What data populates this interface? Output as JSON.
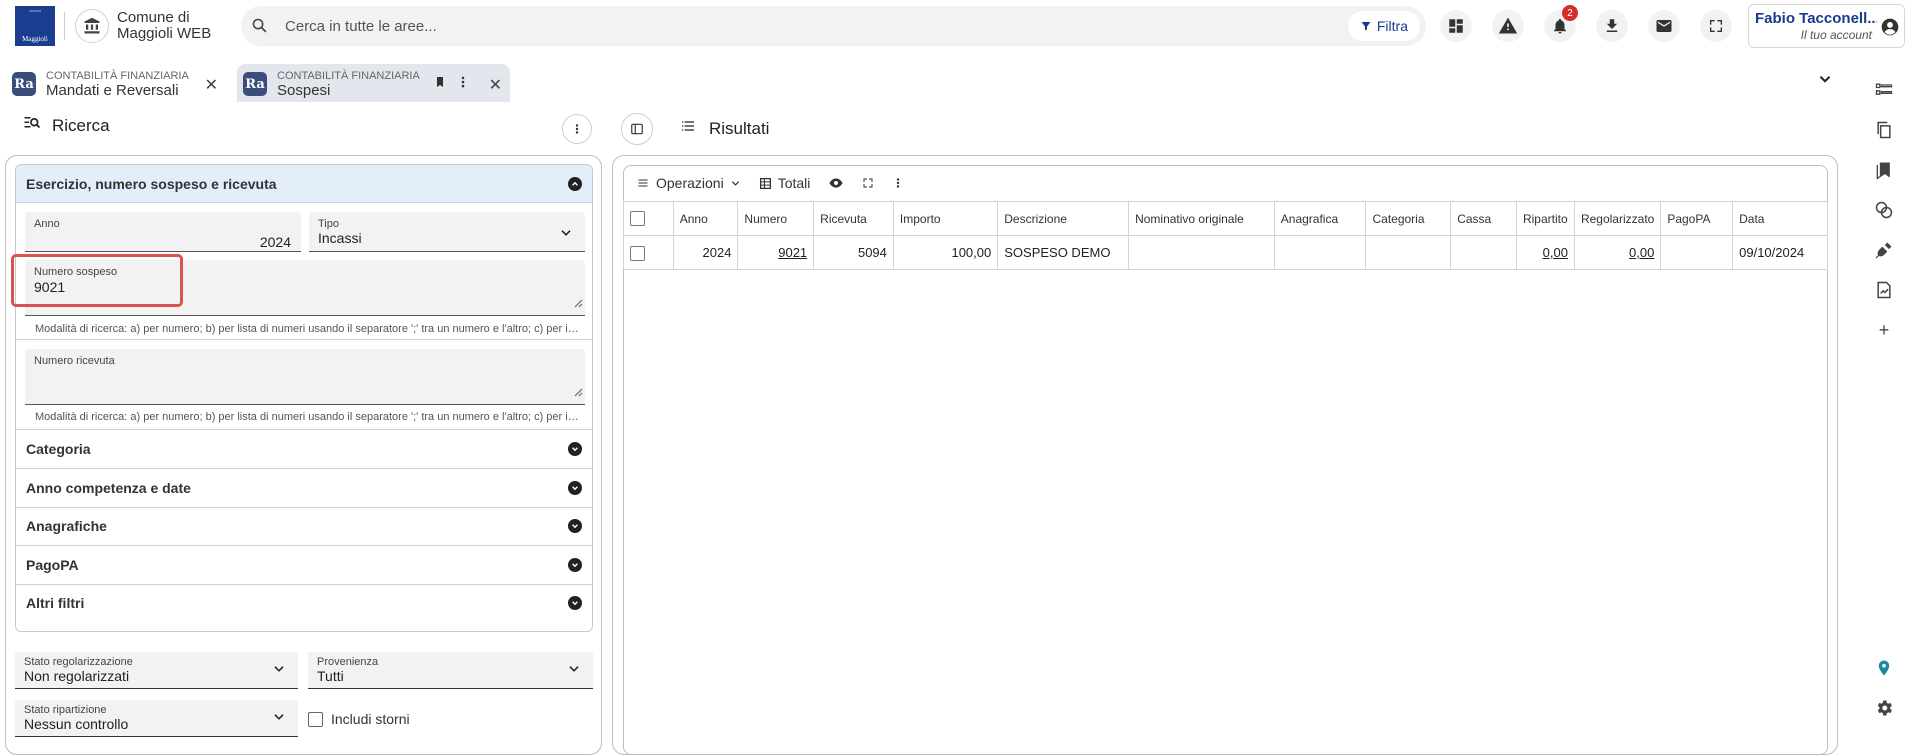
{
  "header": {
    "logo_text": "Maggioli",
    "municipality": "Comune di Maggioli WEB",
    "search_placeholder": "Cerca in tutte le aree...",
    "filter_label": "Filtra",
    "notification_count": "2",
    "account_name": "Fabio Tacconell...",
    "account_sub": "Il tuo account",
    "icons": [
      "dashboard-icon",
      "warning-icon",
      "bell-icon",
      "download-icon",
      "mail-icon",
      "fullscreen-icon",
      "account-circle-icon"
    ]
  },
  "tabs": [
    {
      "section": "CONTABILITÀ FINANZIARIA",
      "name": "Mandati e Reversali",
      "badge": "Ra"
    },
    {
      "section": "CONTABILITÀ FINANZIARIA",
      "name": "Sospesi",
      "badge": "Ra"
    }
  ],
  "search_panel": {
    "title": "Ricerca",
    "section_title": "Esercizio, numero sospeso e ricevuta",
    "anno": {
      "label": "Anno",
      "value": "2024"
    },
    "tipo": {
      "label": "Tipo",
      "value": "Incassi"
    },
    "numero_sospeso": {
      "label": "Numero sospeso",
      "value": "9021"
    },
    "numero_ricevuta": {
      "label": "Numero ricevuta",
      "value": ""
    },
    "hint": "Modalità di ricerca: a) per numero; b) per lista di numeri usando il separatore ';' tra un numero e l'altro; c) per intervallo di numeri",
    "sections": [
      "Categoria",
      "Anno competenza e date",
      "Anagrafiche",
      "PagoPA",
      "Altri filtri"
    ],
    "stato_regolarizzazione": {
      "label": "Stato regolarizzazione",
      "value": "Non regolarizzati"
    },
    "provenienza": {
      "label": "Provenienza",
      "value": "Tutti"
    },
    "stato_ripartizione": {
      "label": "Stato ripartizione",
      "value": "Nessun controllo"
    },
    "includi_storni": "Includi storni"
  },
  "results": {
    "title": "Risultati",
    "toolbar": {
      "operazioni": "Operazioni",
      "totali": "Totali"
    },
    "columns": [
      "Anno",
      "Numero",
      "Ricevuta",
      "Importo",
      "Descrizione",
      "Nominativo originale",
      "Anagrafica",
      "Categoria",
      "Cassa",
      "Ripartito",
      "Regolarizzato",
      "PagoPA",
      "Data"
    ],
    "rows": [
      {
        "anno": "2024",
        "numero": "9021",
        "ricevuta": "5094",
        "importo": "100,00",
        "descrizione": "SOSPESO DEMO",
        "nominativo": "",
        "anagrafica": "",
        "categoria": "",
        "cassa": "",
        "ripartito": "0,00",
        "regolarizzato": "0,00",
        "pagopa": "",
        "data": "09/10/2024"
      }
    ]
  }
}
